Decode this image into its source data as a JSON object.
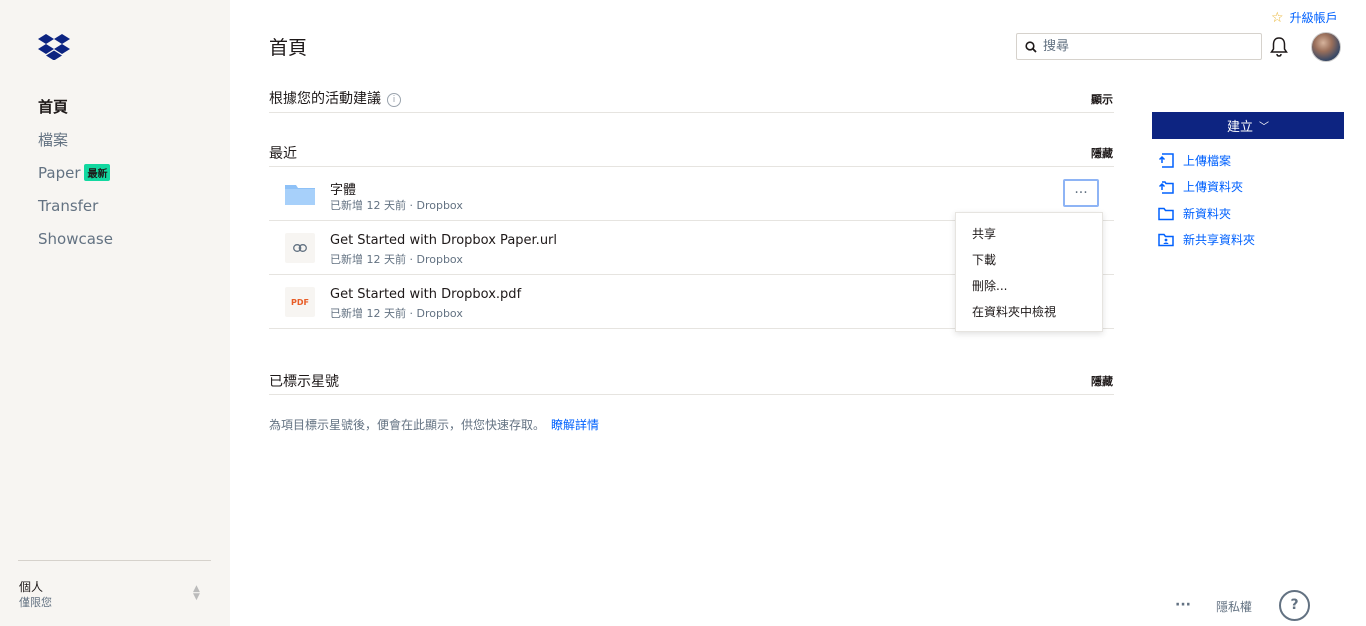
{
  "sidebar": {
    "nav": [
      {
        "label": "首頁",
        "active": true
      },
      {
        "label": "檔案",
        "active": false
      },
      {
        "label": "Paper",
        "active": false,
        "badge": "最新"
      },
      {
        "label": "Transfer",
        "active": false
      },
      {
        "label": "Showcase",
        "active": false
      }
    ],
    "account": {
      "name": "個人",
      "sub": "僅限您"
    }
  },
  "header": {
    "title": "首頁",
    "search_placeholder": "搜尋",
    "upgrade": "升級帳戶"
  },
  "suggestions": {
    "title": "根據您的活動建議",
    "action": "顯示"
  },
  "recent": {
    "title": "最近",
    "action": "隱藏",
    "items": [
      {
        "name": "字體",
        "meta": "已新增 12 天前 · Dropbox",
        "icon": "folder-icon"
      },
      {
        "name": "Get Started with Dropbox Paper.url",
        "meta": "已新增 12 天前 · Dropbox",
        "icon": "link-icon"
      },
      {
        "name": "Get Started with Dropbox.pdf",
        "meta": "已新增 12 天前 · Dropbox",
        "icon": "pdf-icon",
        "thumb_label": "PDF"
      }
    ],
    "more_label": "···"
  },
  "context_menu": [
    "共享",
    "下載",
    "刪除...",
    "在資料夾中檢視"
  ],
  "starred": {
    "title": "已標示星號",
    "action": "隱藏",
    "empty": "為項目標示星號後，便會在此顯示，供您快速存取。",
    "link": "瞭解詳情"
  },
  "right_panel": {
    "create": "建立",
    "actions": [
      "上傳檔案",
      "上傳資料夾",
      "新資料夾",
      "新共享資料夾"
    ]
  },
  "footer": {
    "more": "···",
    "privacy": "隱私權",
    "help": "?"
  },
  "colors": {
    "accent": "#0061fe",
    "create_button": "#0d2481",
    "badge": "#12d8a0"
  }
}
